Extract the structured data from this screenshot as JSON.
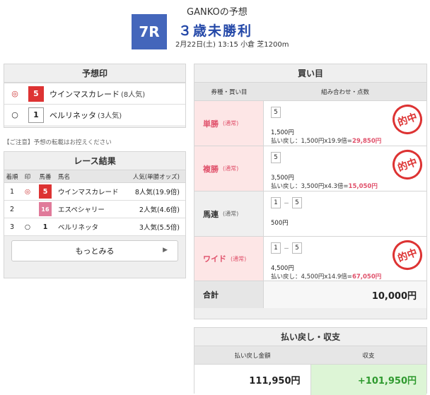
{
  "header": {
    "subtitle": "GANKOの予想",
    "race_number": "7R",
    "race_name": "３歳未勝利",
    "race_info": "2月22日(土) 13:15 小倉 芝1200m"
  },
  "prediction": {
    "title": "予想印",
    "rows": [
      {
        "mark": "◎",
        "number": "5",
        "name": "ウインマスカレード",
        "popularity": "(8人気)"
      },
      {
        "mark": "○",
        "number": "1",
        "name": "ベルリネッタ",
        "popularity": "(3人気)"
      }
    ]
  },
  "notice": "【ご注意】予想の転載はお控えください",
  "results": {
    "title": "レース結果",
    "headers": {
      "rank": "着順",
      "mark": "印",
      "number": "馬番",
      "name": "馬名",
      "pop": "人気(単勝オッズ)"
    },
    "rows": [
      {
        "rank": "1",
        "mark": "◎",
        "number": "5",
        "name": "ウインマスカレード",
        "pop": "8人気(19.9倍)"
      },
      {
        "rank": "2",
        "mark": "",
        "number": "16",
        "name": "エスペシャリー",
        "pop": "2人気(4.6倍)"
      },
      {
        "rank": "3",
        "mark": "○",
        "number": "1",
        "name": "ベルリネッタ",
        "pop": "3人気(5.5倍)"
      }
    ],
    "more_label": "もっとみる",
    "more_icon": "chevron-right-icon"
  },
  "bets": {
    "title": "買い目",
    "head_type": "券種・買い目",
    "head_combo": "組み合わせ・点数",
    "stamp_text": "的中",
    "rows": [
      {
        "type": "単勝",
        "kind": "(通常)",
        "hit": true,
        "combo": [
          "5"
        ],
        "amount": "1,500円",
        "payout_label": "払い戻し",
        "payout_calc": "：1,500円x19.9倍=",
        "payout_result": "29,850円"
      },
      {
        "type": "複勝",
        "kind": "(通常)",
        "hit": true,
        "combo": [
          "5"
        ],
        "amount": "3,500円",
        "payout_label": "払い戻し",
        "payout_calc": "：3,500円x4.3倍=",
        "payout_result": "15,050円"
      },
      {
        "type": "馬連",
        "kind": "(通常)",
        "hit": false,
        "combo": [
          "1",
          "5"
        ],
        "amount": "500円",
        "payout_label": "",
        "payout_calc": "",
        "payout_result": ""
      },
      {
        "type": "ワイド",
        "kind": "(通常)",
        "hit": true,
        "combo": [
          "1",
          "5"
        ],
        "amount": "4,500円",
        "payout_label": "払い戻し",
        "payout_calc": "：4,500円x14.9倍=",
        "payout_result": "67,050円"
      }
    ],
    "combo_sep": "－",
    "total_label": "合計",
    "total_value": "10,000円"
  },
  "summary": {
    "title": "払い戻し・収支",
    "head_payout": "払い戻し金額",
    "head_balance": "収支",
    "payout": "111,950円",
    "balance": "+101,950円"
  },
  "colors": {
    "race_badge": "#4466bb",
    "race_name": "#2448a8",
    "hit_pink": "#e0506a",
    "stamp_red": "#dd3333",
    "balance_green": "#2f9a2f"
  }
}
